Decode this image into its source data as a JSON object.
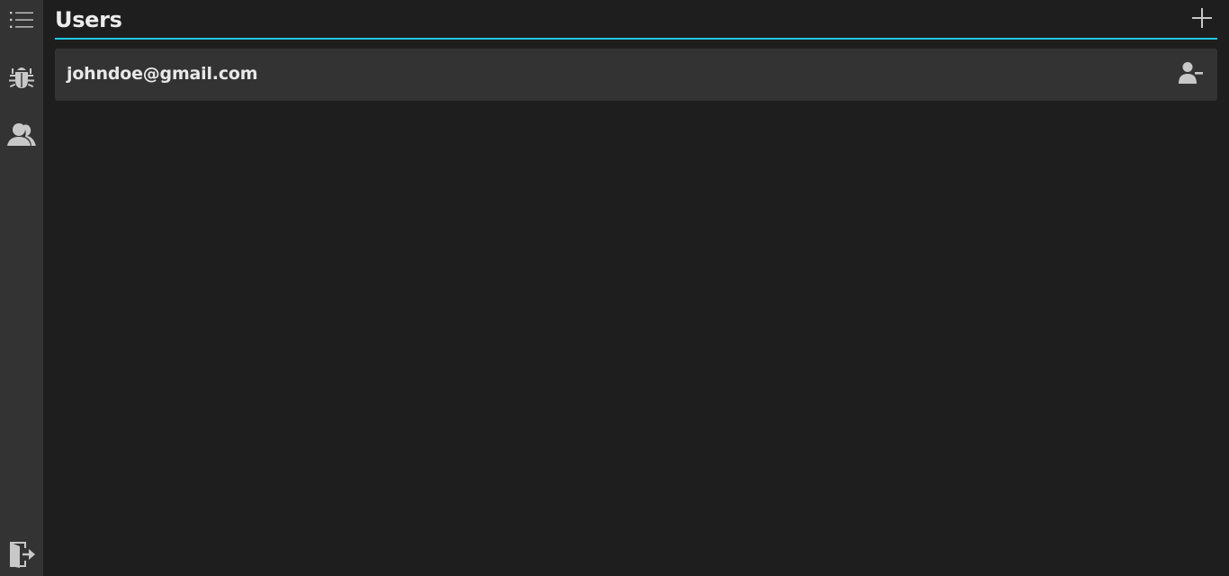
{
  "sidebar": {
    "items": [
      {
        "icon": "list-icon"
      },
      {
        "icon": "bug-icon"
      },
      {
        "icon": "users-icon"
      }
    ],
    "footer": {
      "icon": "logout-icon"
    }
  },
  "header": {
    "title": "Users",
    "add_icon": "plus-icon"
  },
  "users": [
    {
      "email": "johndoe@gmail.com",
      "action_icon": "remove-user-icon"
    }
  ],
  "colors": {
    "background": "#1e1e1e",
    "sidebar": "#333333",
    "row": "#333333",
    "accent": "#1ec8e6",
    "text": "#ececec",
    "icon": "#c8c8c8"
  }
}
